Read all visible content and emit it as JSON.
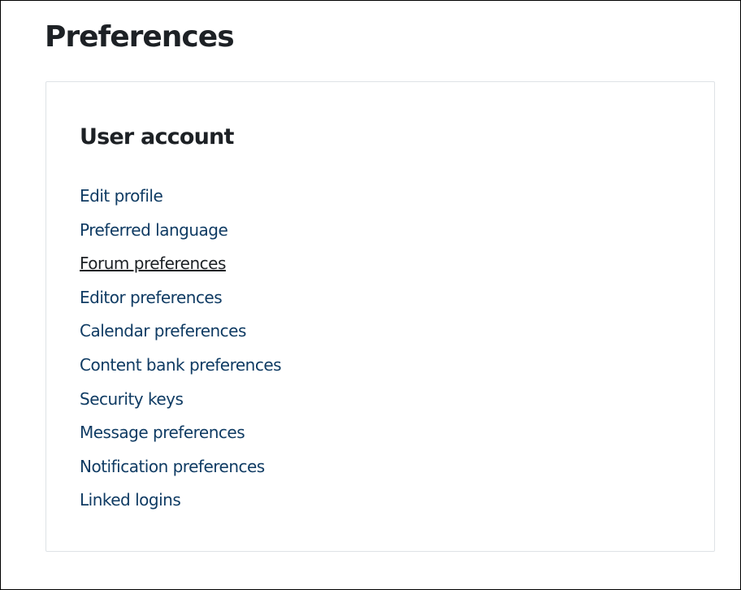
{
  "page": {
    "title": "Preferences"
  },
  "user_account": {
    "heading": "User account",
    "links": [
      {
        "label": "Edit profile",
        "hovered": false
      },
      {
        "label": "Preferred language",
        "hovered": false
      },
      {
        "label": "Forum preferences",
        "hovered": true
      },
      {
        "label": "Editor preferences",
        "hovered": false
      },
      {
        "label": "Calendar preferences",
        "hovered": false
      },
      {
        "label": "Content bank preferences",
        "hovered": false
      },
      {
        "label": "Security keys",
        "hovered": false
      },
      {
        "label": "Message preferences",
        "hovered": false
      },
      {
        "label": "Notification preferences",
        "hovered": false
      },
      {
        "label": "Linked logins",
        "hovered": false
      }
    ]
  },
  "colors": {
    "link": "#0f3b63",
    "heading": "#1d2125",
    "card_border": "#dee2e6",
    "frame_border": "#000000"
  }
}
